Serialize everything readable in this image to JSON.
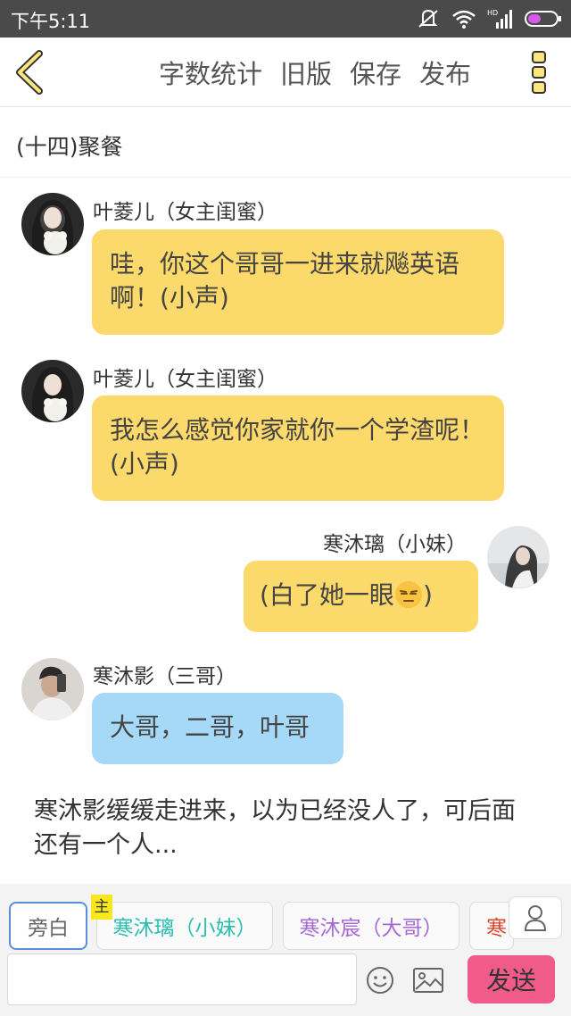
{
  "status_bar": {
    "time": "下午5:11",
    "network": "HD"
  },
  "toolbar": {
    "word_count": "字数统计",
    "old_version": "旧版",
    "save": "保存",
    "publish": "发布"
  },
  "chapter_title": "(十四)聚餐",
  "messages": [
    {
      "speaker": "叶菱儿（女主闺蜜）",
      "text": "哇，你这个哥哥一进来就飚英语啊！(小声)",
      "bubble_color": "#fcd96b",
      "side": "left"
    },
    {
      "speaker": "叶菱儿（女主闺蜜）",
      "text": "我怎么感觉你家就你一个学渣呢！(小声)",
      "bubble_color": "#fcd96b",
      "side": "left"
    },
    {
      "speaker": "寒沐璃（小妹）",
      "text_before": "(白了她一眼",
      "text_after": ")",
      "emoji": "unamused-face-emoji",
      "bubble_color": "#fcd96b",
      "side": "right"
    },
    {
      "speaker": "寒沐影（三哥）",
      "text": "大哥，二哥，叶哥",
      "bubble_color": "#a5d9f7",
      "side": "left"
    }
  ],
  "narration": "寒沐影缓缓走进来，以为已经没人了，可后面还有一个人...",
  "characters": [
    {
      "label": "旁白",
      "color": "#666666",
      "selected": true
    },
    {
      "label": "寒沐璃（小妹）",
      "color": "#2bbfb0",
      "badge": "主"
    },
    {
      "label": "寒沐宸（大哥）",
      "color": "#a66ad4"
    },
    {
      "label": "寒",
      "color": "#e0452b"
    }
  ],
  "input": {
    "placeholder": ""
  },
  "send_label": "发送",
  "colors": {
    "accent_yellow": "#fcd96b",
    "accent_blue": "#a5d9f7",
    "send_pink": "#f05b8c"
  }
}
